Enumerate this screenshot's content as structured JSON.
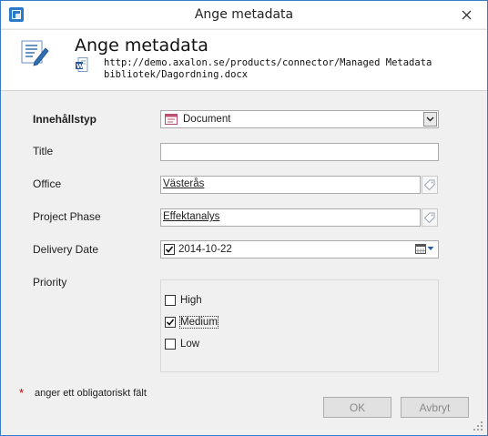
{
  "window": {
    "title": "Ange metadata",
    "close_icon": "close-icon",
    "app_icon": "app-icon"
  },
  "header": {
    "title": "Ange metadata",
    "url_line1": "http://demo.axalon.se/products/connector/Managed Metadata",
    "url_line2": "bibliotek/Dagordning.docx",
    "icon": "edit-document-icon",
    "doc_icon": "word-document-icon"
  },
  "form": {
    "content_type": {
      "label": "Innehållstyp",
      "value": "Document"
    },
    "title": {
      "label": "Title",
      "value": ""
    },
    "office": {
      "label": "Office",
      "value": "Västerås"
    },
    "project_phase": {
      "label": "Project Phase",
      "value": "Effektanalys"
    },
    "delivery_date": {
      "label": "Delivery Date",
      "value": "2014-10-22",
      "checked": true
    },
    "priority": {
      "label": "Priority",
      "options": [
        {
          "label": "High",
          "checked": false
        },
        {
          "label": "Medium",
          "checked": true
        },
        {
          "label": "Low",
          "checked": false
        }
      ]
    }
  },
  "footer": {
    "required_marker": "*",
    "required_note": "anger ett obligatoriskt fält",
    "ok_label": "OK",
    "cancel_label": "Avbryt"
  },
  "colors": {
    "window_border": "#3b7ac4",
    "dialog_background": "#f0f0f0",
    "required_star": "#c00000"
  }
}
